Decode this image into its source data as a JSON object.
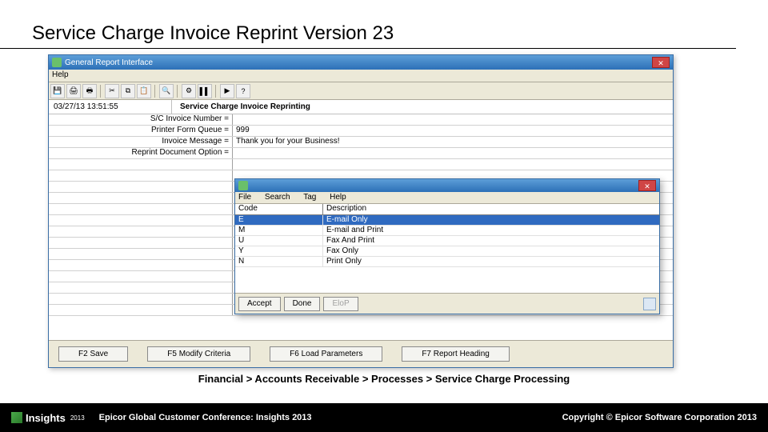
{
  "slide_title": "Service Charge Invoice Reprint Version 23",
  "window": {
    "title": "General Report Interface",
    "menu": {
      "help": "Help"
    },
    "timestamp": "03/27/13 13:51:55",
    "report_name": "Service Charge Invoice Reprinting",
    "form_rows": [
      {
        "label": "S/C Invoice Number =",
        "value": ""
      },
      {
        "label": "Printer Form Queue =",
        "value": "999"
      },
      {
        "label": "Invoice Message =",
        "value": "Thank you for your Business!"
      },
      {
        "label": "Reprint Document Option =",
        "value": ""
      }
    ],
    "bottom_buttons": [
      "F2 Save",
      "F5 Modify Criteria",
      "F6 Load Parameters",
      "F7 Report Heading"
    ]
  },
  "popup": {
    "menu": [
      "File",
      "Search",
      "Tag",
      "Help"
    ],
    "headers": {
      "code": "Code",
      "desc": "Description"
    },
    "rows": [
      {
        "code": "E",
        "desc": "E-mail Only",
        "selected": true
      },
      {
        "code": "M",
        "desc": "E-mail and Print",
        "selected": false
      },
      {
        "code": "U",
        "desc": "Fax And Print",
        "selected": false
      },
      {
        "code": "Y",
        "desc": "Fax Only",
        "selected": false
      },
      {
        "code": "N",
        "desc": "Print Only",
        "selected": false
      }
    ],
    "footer_buttons": [
      {
        "label": "Accept",
        "disabled": false
      },
      {
        "label": "Done",
        "disabled": false
      },
      {
        "label": "EloP",
        "disabled": true
      }
    ]
  },
  "breadcrumb": "Financial > Accounts Receivable > Processes > Service Charge Processing",
  "footer": {
    "brand": "Insights",
    "year": "2013",
    "conference": "Epicor Global Customer Conference: Insights 2013",
    "copyright": "Copyright © Epicor Software Corporation 2013"
  },
  "icons": {
    "toolbar": [
      "disk",
      "print",
      "printer2",
      "cut",
      "copy",
      "paste",
      "find",
      "gear",
      "stop",
      "run",
      "help"
    ]
  }
}
